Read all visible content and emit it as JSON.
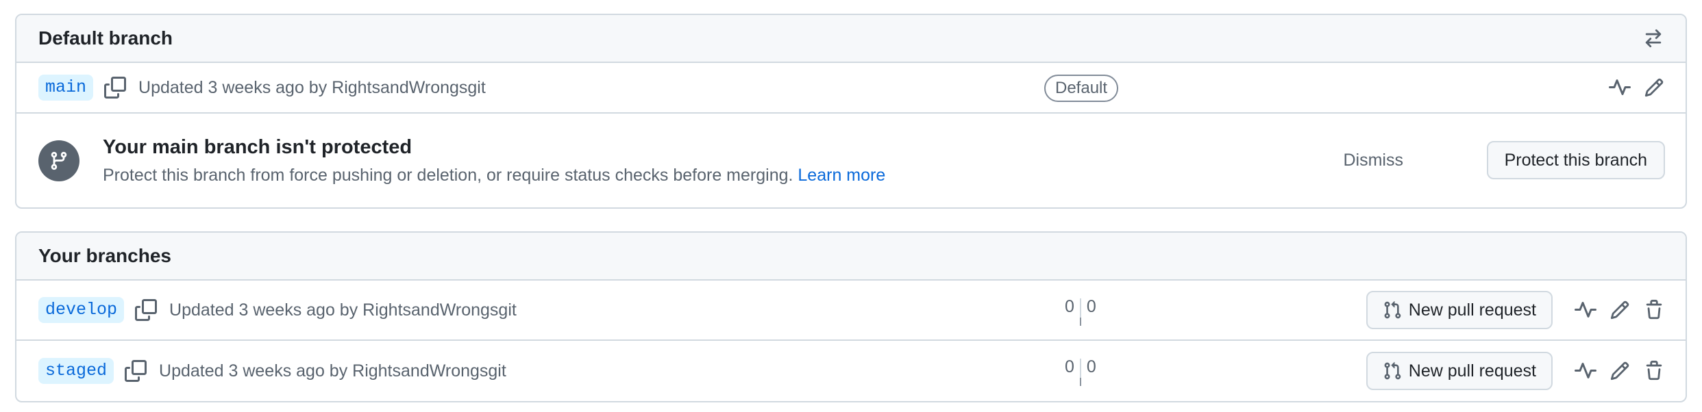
{
  "default_section": {
    "title": "Default branch",
    "switch_icon": "arrow-switch-icon",
    "main_row": {
      "branch": "main",
      "updated": "Updated 3 weeks ago by RightsandWrongsgit",
      "badge": "Default",
      "icons": [
        "copy-icon",
        "activity-icon",
        "pencil-icon"
      ]
    },
    "protection": {
      "icon": "git-branch-icon",
      "title": "Your main branch isn't protected",
      "description": "Protect this branch from force pushing or deletion, or require status checks before merging.",
      "learn_more": "Learn more",
      "dismiss": "Dismiss",
      "protect_button": "Protect this branch"
    }
  },
  "your_branches": {
    "title": "Your branches",
    "rows": [
      {
        "branch": "develop",
        "updated": "Updated 3 weeks ago by RightsandWrongsgit",
        "behind": "0",
        "ahead": "0",
        "pr_button": "New pull request"
      },
      {
        "branch": "staged",
        "updated": "Updated 3 weeks ago by RightsandWrongsgit",
        "behind": "0",
        "ahead": "0",
        "pr_button": "New pull request"
      }
    ]
  },
  "colors": {
    "accent": "#0969da",
    "pill_bg": "#ddf4ff",
    "muted": "#59636e",
    "border": "#d1d9e0",
    "header_bg": "#f6f8fa"
  }
}
